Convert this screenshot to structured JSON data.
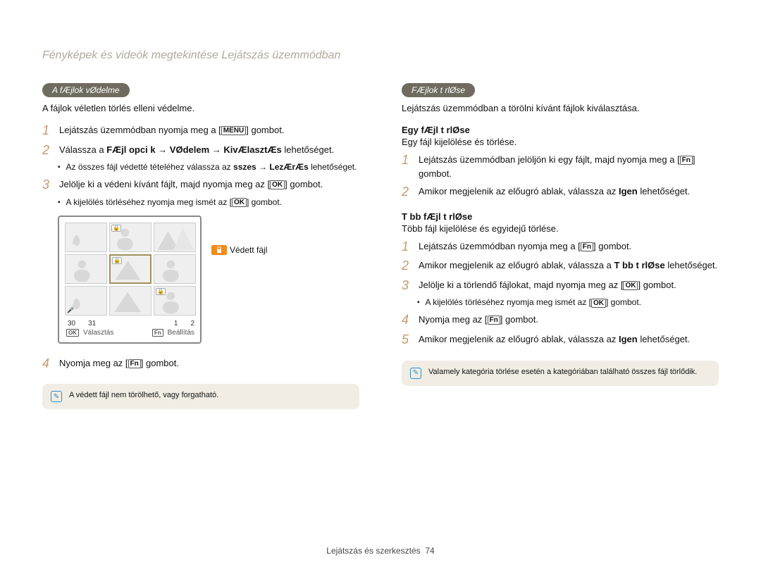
{
  "page_title": "Fényképek és videók megtekintése Lejátszás üzemmódban",
  "left": {
    "badge": "A fÆjlok vØdelme",
    "intro": "A fájlok véletlen törlés elleni védelme.",
    "step1_a": "Lejátszás üzemmódban nyomja meg a [",
    "step1_menu": "MENU",
    "step1_b": "] gombot.",
    "step2_a": "Válassza a ",
    "step2_b": "FÆjl opci k",
    "step2_arrow": " → ",
    "step2_c": "VØdelem",
    "step2_d": "KivÆlasztÆs",
    "step2_end": " lehetőséget.",
    "step2_bullet_a": "Az összes fájl védetté tételéhez válassza az ",
    "step2_bullet_b": " sszes",
    "step2_bullet_c": "LezÆrÆs",
    "step2_bullet_d": "lehetőséget.",
    "step3_a": "Jelölje ki a védeni kívánt fájlt, majd nyomja meg az [",
    "step3_ok": "OK",
    "step3_b": "] gombot.",
    "step3_bullet": "A kijelölés törléséhez nyomja meg ismét az [",
    "step3_bullet_ok": "OK",
    "step3_bullet_end": "] gombot.",
    "step4_a": "Nyomja meg az [",
    "step4_fn": "Fn",
    "step4_b": "] gombot.",
    "grid_date": {
      "d": "30",
      "m": "31",
      "spacer": "1",
      "y": "2"
    },
    "legend_ok": "OK",
    "legend_sel": "Választás",
    "legend_fn": "Fn",
    "legend_set": "Beállítás",
    "callout": "Védett fájl",
    "tip": "A védett fájl nem törölhető, vagy forgatható."
  },
  "right": {
    "badge": "FÆjlok t rlØse",
    "intro": "Lejátszás üzemmódban a törölni kívánt fájlok kiválasztása.",
    "sub1_h": "Egy fÆjl t rlØse",
    "sub1_d": "Egy fájl kijelölése és törlése.",
    "s1_1a": "Lejátszás üzemmódban jelöljön ki egy fájlt, majd nyomja meg a [",
    "s1_1fn": "Fn",
    "s1_1b": "] gombot.",
    "s1_2a": "Amikor megjelenik az előugró ablak, válassza az ",
    "s1_2b": "Igen",
    "s1_2c": " lehetőséget.",
    "sub2_h": "T bb fÆjl t rlØse",
    "sub2_d": "Több fájl kijelölése és egyidejű törlése.",
    "s2_1a": "Lejátszás üzemmódban nyomja meg a [",
    "s2_1fn": "Fn",
    "s2_1b": "] gombot.",
    "s2_2a": "Amikor megjelenik az előugró ablak, válassza a ",
    "s2_2b": "T bb t rlØse",
    "s2_2c": " lehetőséget.",
    "s2_3a": "Jelölje ki a törlendő fájlokat, majd nyomja meg az [",
    "s2_3ok": "OK",
    "s2_3b": "] gombot.",
    "s2_3bullet": "A kijelölés törléséhez nyomja meg ismét az [",
    "s2_3bullet_ok": "OK",
    "s2_3bullet_end": "] gombot.",
    "s2_4a": "Nyomja meg az [",
    "s2_4fn": "Fn",
    "s2_4b": "] gombot.",
    "s2_5a": "Amikor megjelenik az előugró ablak, válassza az ",
    "s2_5b": "Igen",
    "s2_5c": " lehetőséget.",
    "tip": "Valamely kategória törlése esetén a kategóriában található összes fájl törlődik."
  },
  "footer_a": "Lejátszás és szerkesztés",
  "footer_b": "74"
}
